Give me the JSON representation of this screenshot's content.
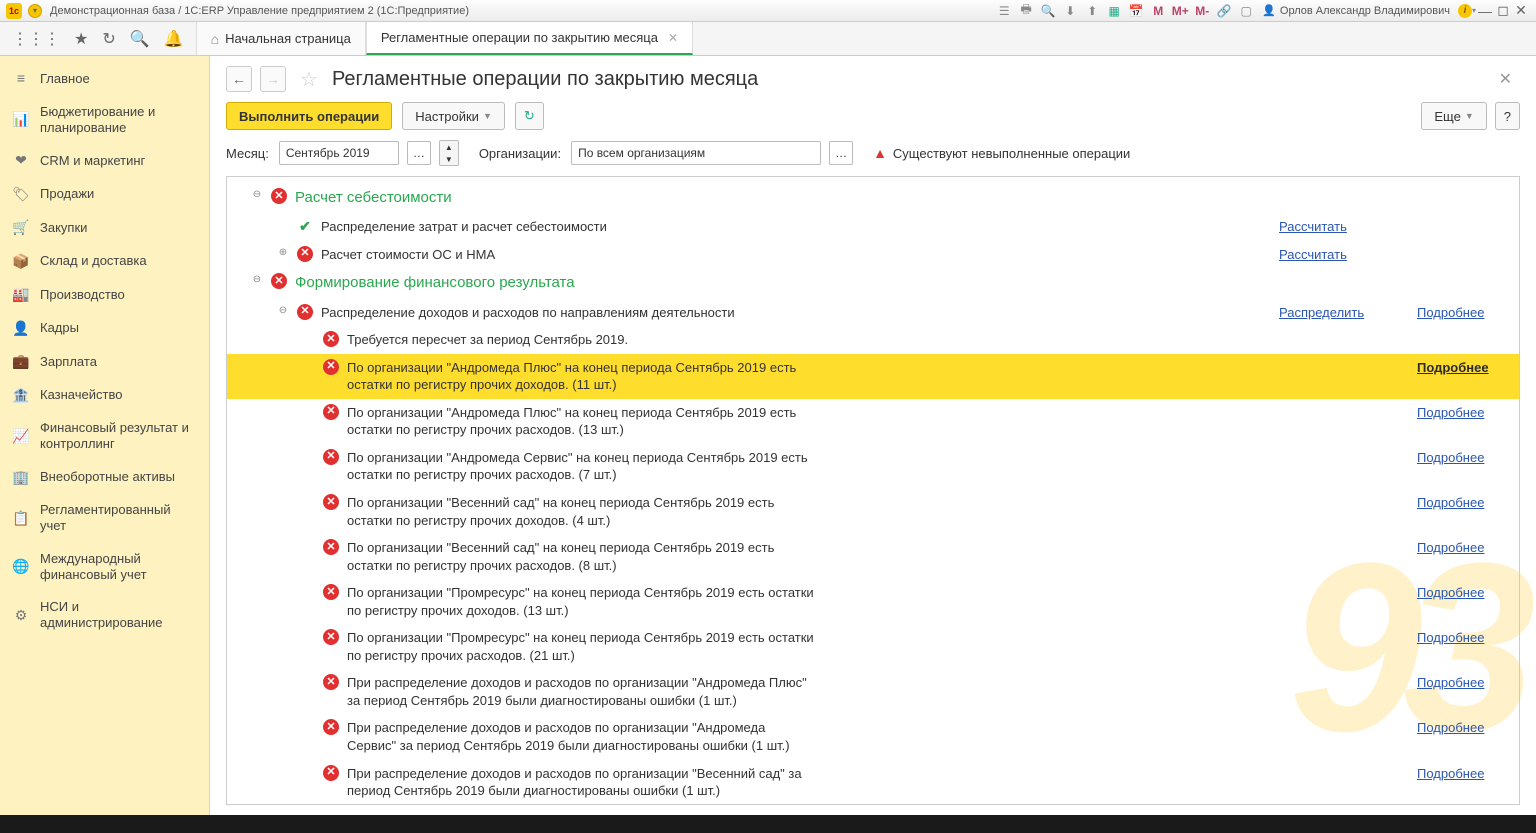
{
  "titlebar": {
    "title": "Демонстрационная база / 1С:ERP Управление предприятием 2  (1С:Предприятие)",
    "user": "Орлов Александр Владимирович",
    "m_labels": [
      "M",
      "M+",
      "M-"
    ]
  },
  "tabs": {
    "home": "Начальная страница",
    "active": "Регламентные операции по закрытию месяца"
  },
  "sidebar": {
    "items": [
      {
        "icon": "≡",
        "label": "Главное"
      },
      {
        "icon": "📊",
        "label": "Бюджетирование и планирование"
      },
      {
        "icon": "❤",
        "label": "CRM и маркетинг"
      },
      {
        "icon": "🏷",
        "label": "Продажи"
      },
      {
        "icon": "🛒",
        "label": "Закупки"
      },
      {
        "icon": "📦",
        "label": "Склад и доставка"
      },
      {
        "icon": "🏭",
        "label": "Производство"
      },
      {
        "icon": "👤",
        "label": "Кадры"
      },
      {
        "icon": "💼",
        "label": "Зарплата"
      },
      {
        "icon": "🏦",
        "label": "Казначейство"
      },
      {
        "icon": "📈",
        "label": "Финансовый результат и контроллинг"
      },
      {
        "icon": "🏢",
        "label": "Внеоборотные активы"
      },
      {
        "icon": "📋",
        "label": "Регламентированный учет"
      },
      {
        "icon": "🌐",
        "label": "Международный финансовый учет"
      },
      {
        "icon": "⚙",
        "label": "НСИ и администрирование"
      }
    ]
  },
  "header": {
    "title": "Регламентные операции по закрытию месяца"
  },
  "toolbar": {
    "execute": "Выполнить операции",
    "settings": "Настройки",
    "more": "Еще",
    "help": "?"
  },
  "filters": {
    "month_label": "Месяц:",
    "month_value": "Сентябрь 2019",
    "org_label": "Организации:",
    "org_value": "По всем организациям",
    "warning": "Существуют невыполненные операции"
  },
  "links": {
    "calc": "Рассчитать",
    "distribute": "Распределить",
    "details": "Подробнее"
  },
  "tree": {
    "g1": "Расчет себестоимости",
    "g1_r1": "Распределение затрат и расчет себестоимости",
    "g1_r2": "Расчет стоимости ОС и НМА",
    "g2": "Формирование финансового результата",
    "g2_r1": "Распределение доходов и расходов по направлениям деятельности",
    "g2_r1_c1": "Требуется пересчет за период Сентябрь 2019.",
    "g2_r1_c2": "По организации \"Андромеда Плюс\" на конец периода Сентябрь 2019 есть остатки по регистру прочих доходов. (11 шт.)",
    "g2_r1_c3": "По организации \"Андромеда Плюс\" на конец периода Сентябрь 2019 есть остатки по регистру прочих расходов. (13 шт.)",
    "g2_r1_c4": "По организации \"Андромеда Сервис\" на конец периода Сентябрь 2019 есть остатки по регистру прочих расходов. (7 шт.)",
    "g2_r1_c5": "По организации \"Весенний сад\" на конец периода Сентябрь 2019 есть остатки по регистру прочих доходов. (4 шт.)",
    "g2_r1_c6": "По организации \"Весенний сад\" на конец периода Сентябрь 2019 есть остатки по регистру прочих расходов. (8 шт.)",
    "g2_r1_c7": "По организации \"Промресурс\" на конец периода Сентябрь 2019 есть остатки по регистру прочих доходов. (13 шт.)",
    "g2_r1_c8": "По организации \"Промресурс\" на конец периода Сентябрь 2019 есть остатки по регистру прочих расходов. (21 шт.)",
    "g2_r1_c9": "При распределение доходов и расходов по организации \"Андромеда Плюс\" за период Сентябрь 2019 были диагностированы ошибки (1 шт.)",
    "g2_r1_c10": "При распределение доходов и расходов по организации \"Андромеда Сервис\" за период Сентябрь 2019 были диагностированы ошибки (1 шт.)",
    "g2_r1_c11": "При распределение доходов и расходов по организации \"Весенний сад\" за период Сентябрь 2019 были диагностированы ошибки (1 шт.)"
  }
}
